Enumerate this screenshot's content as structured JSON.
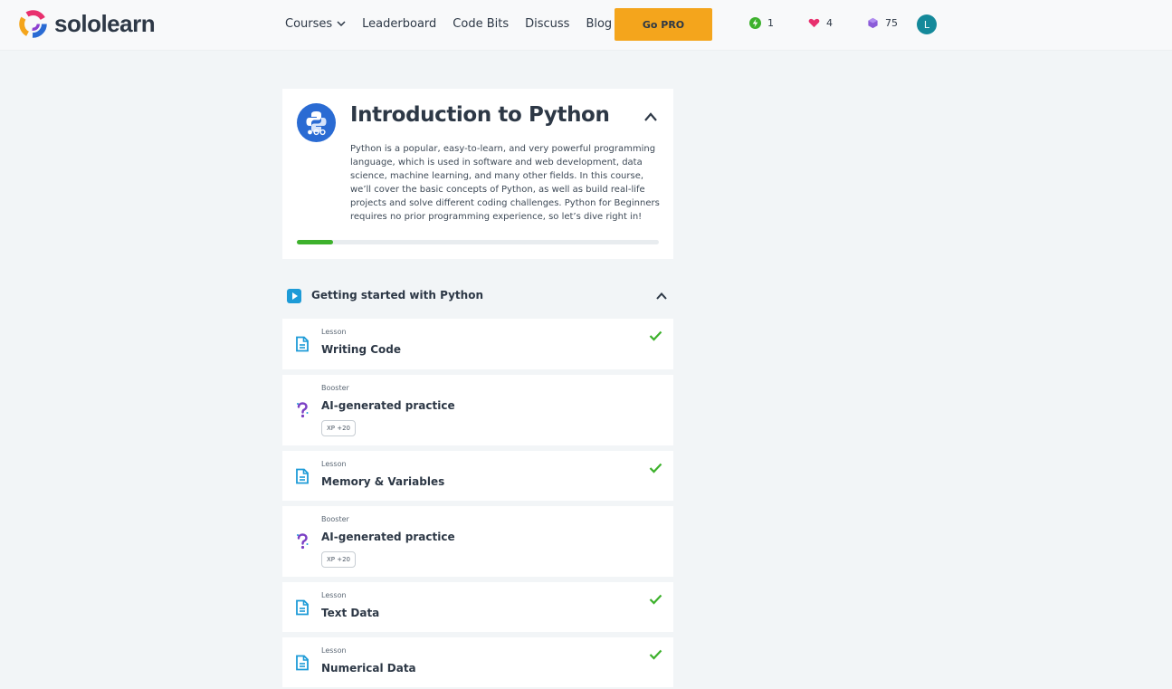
{
  "header": {
    "logo_text": "sololearn",
    "nav": [
      "Courses",
      "Leaderboard",
      "Code Bits",
      "Discuss",
      "Blog"
    ],
    "pro_button": "Go PRO",
    "streak": "1",
    "hearts": "4",
    "bits": "75",
    "avatar_letter": "L"
  },
  "course": {
    "title": "Introduction to Python",
    "description": "Python is a popular, easy-to-learn, and very powerful programming language, which is used in software and web development, data science, machine learning, and many other fields. In this course, we’ll cover the basic concepts of Python, as well as build real-life projects and solve different coding challenges. Python for Beginners requires no prior programming experience, so let’s dive right in!",
    "progress": 0.1
  },
  "module": {
    "title": "Getting started with Python"
  },
  "items": [
    {
      "type": "Lesson",
      "title": "Writing Code",
      "kind": "lesson",
      "completed": true
    },
    {
      "type": "Booster",
      "title": "AI-generated practice",
      "kind": "booster",
      "xp": "XP +20"
    },
    {
      "type": "Lesson",
      "title": "Memory & Variables",
      "kind": "lesson",
      "completed": true
    },
    {
      "type": "Booster",
      "title": "AI-generated practice",
      "kind": "booster",
      "xp": "XP +20"
    },
    {
      "type": "Lesson",
      "title": "Text Data",
      "kind": "lesson",
      "completed": true
    },
    {
      "type": "Lesson",
      "title": "Numerical Data",
      "kind": "lesson",
      "completed": true
    }
  ],
  "colors": {
    "accent_orange": "#f4a51c",
    "progress_green": "#3db12c",
    "lesson_blue": "#1d9bd7",
    "booster_purple": "#7b3fc4"
  }
}
